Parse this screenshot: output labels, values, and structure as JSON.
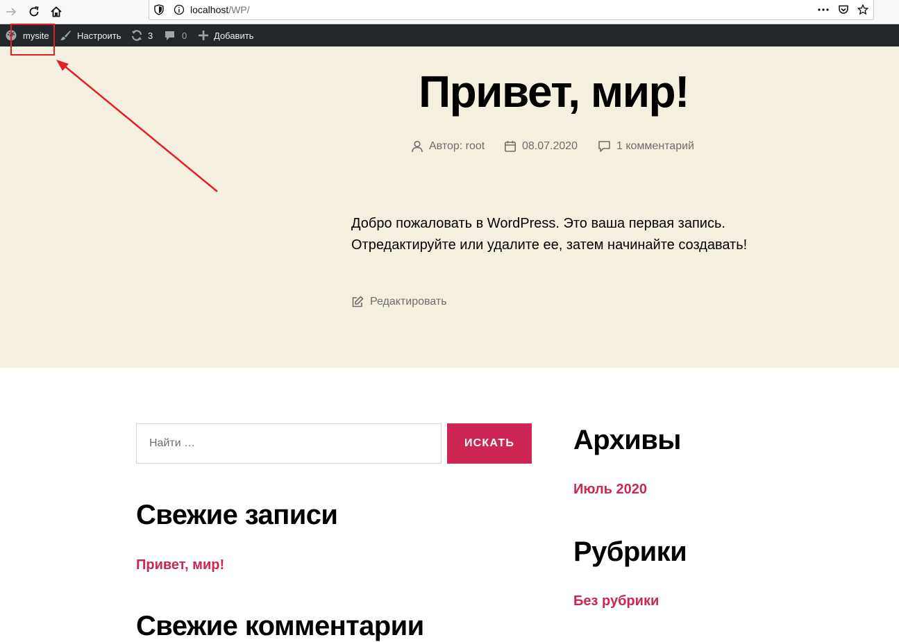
{
  "browser": {
    "url_host": "localhost",
    "url_path": "/WP/",
    "icons": [
      "forward-arrow-icon",
      "reload-icon",
      "home-icon",
      "shield-icon",
      "info-icon",
      "more-dots-icon",
      "pocket-icon",
      "bookmark-star-icon"
    ]
  },
  "adminbar": {
    "site_name": "mysite",
    "customize": "Настроить",
    "updates_count": "3",
    "comments_count": "0",
    "add_new": "Добавить",
    "bg_color": "#23282d"
  },
  "post": {
    "title": "Привет, мир!",
    "author": "Автор: root",
    "date": "08.07.2020",
    "comments": "1 комментарий",
    "content": "Добро пожаловать в WordPress. Это ваша первая запись. Отредактируйте или удалите ее, затем начинайте создавать!",
    "edit": "Редактировать",
    "hero_bg": "#f5efe0"
  },
  "search": {
    "placeholder": "Найти …",
    "button": "ИСКАТЬ",
    "accent": "#cd2653"
  },
  "widgets": {
    "recent_posts_title": "Свежие записи",
    "recent_posts": [
      "Привет, мир!"
    ],
    "recent_comments_title": "Свежие комментарии",
    "archives_title": "Архивы",
    "archives": [
      "Июль 2020"
    ],
    "categories_title": "Рубрики",
    "categories": [
      "Без рубрики"
    ]
  }
}
